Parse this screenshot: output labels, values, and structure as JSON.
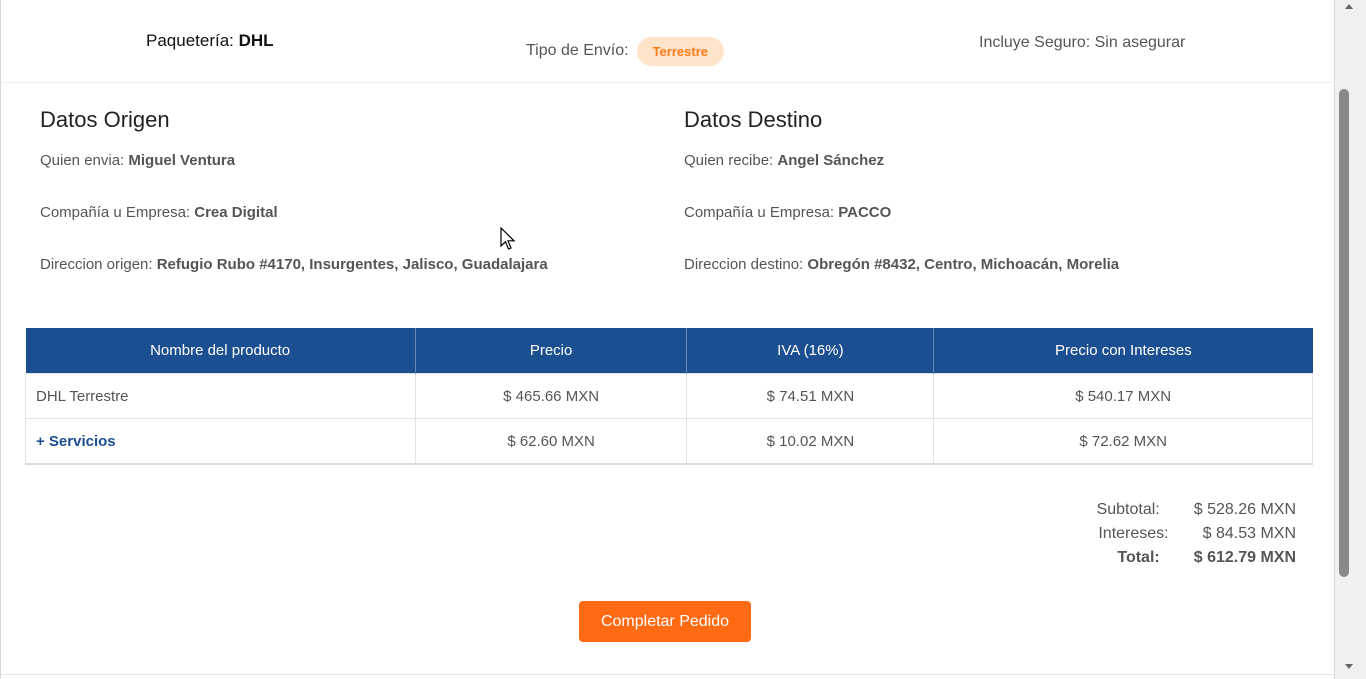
{
  "summary": {
    "carrier_label": "Paquetería: ",
    "carrier_value": "DHL",
    "ship_type_label": "Tipo de Envío:",
    "ship_type_value": "Terrestre",
    "insurance_text": "Incluye Seguro: Sin asegurar"
  },
  "origin": {
    "title": "Datos Origen",
    "sender_label": "Quien envia: ",
    "sender_value": "Miguel Ventura",
    "company_label": "Compañía u Empresa: ",
    "company_value": "Crea Digital",
    "address_label": "Direccion origen: ",
    "address_value": "Refugio Rubo #4170, Insurgentes, Jalisco, Guadalajara"
  },
  "destination": {
    "title": "Datos Destino",
    "recipient_label": "Quien recibe: ",
    "recipient_value": "Angel Sánchez",
    "company_label": "Compañía u Empresa: ",
    "company_value": "PACCO",
    "address_label": "Direccion destino: ",
    "address_value": "Obregón #8432, Centro, Michoacán, Morelia"
  },
  "table": {
    "headers": [
      "Nombre del producto",
      "Precio",
      "IVA (16%)",
      "Precio con Intereses"
    ],
    "rows": [
      [
        "DHL Terrestre",
        "$ 465.66 MXN",
        "$ 74.51 MXN",
        "$ 540.17 MXN"
      ],
      [
        "+ Servicios",
        "$ 62.60 MXN",
        "$ 10.02 MXN",
        "$ 72.62 MXN"
      ]
    ]
  },
  "totals": {
    "subtotal_label": "Subtotal:",
    "subtotal_value": "$ 528.26 MXN",
    "interest_label": "Intereses:",
    "interest_value": "$ 84.53 MXN",
    "total_label": "Total:",
    "total_value": "$ 612.79 MXN"
  },
  "actions": {
    "complete_label": "Completar Pedido"
  },
  "colors": {
    "header_blue": "#1c4f91",
    "accent_orange": "#ff6a13",
    "badge_bg": "#ffe4c9"
  }
}
